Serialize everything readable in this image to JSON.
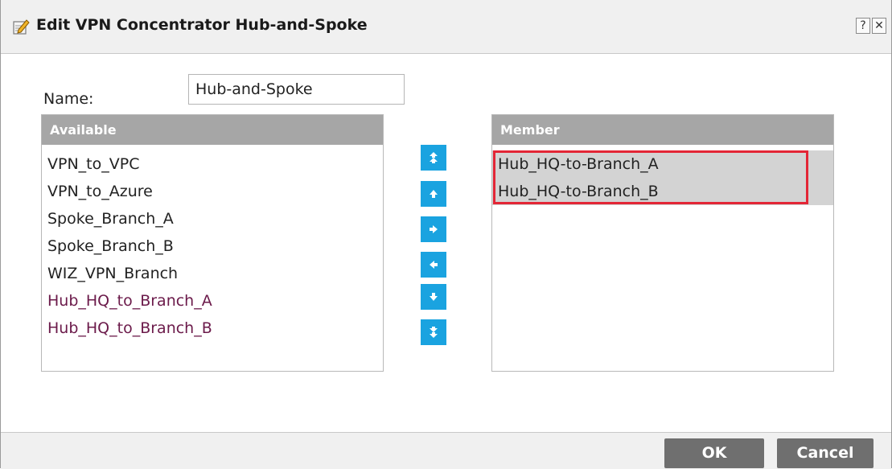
{
  "dialog": {
    "title": "Edit VPN Concentrator Hub-and-Spoke",
    "help_label": "?",
    "close_label": "✕"
  },
  "form": {
    "name_label": "Name:",
    "name_value": "Hub-and-Spoke"
  },
  "available": {
    "header": "Available",
    "items": [
      "VPN_to_VPC",
      "VPN_to_Azure",
      "Spoke_Branch_A",
      "Spoke_Branch_B",
      "WIZ_VPN_Branch",
      "Hub_HQ_to_Branch_A",
      "Hub_HQ_to_Branch_B"
    ]
  },
  "member": {
    "header": "Member",
    "items": [
      "Hub_HQ-to-Branch_A",
      "Hub_HQ-to-Branch_B"
    ]
  },
  "mover_buttons": [
    {
      "icon": "double-up-arrow-icon"
    },
    {
      "icon": "up-arrow-icon"
    },
    {
      "icon": "right-arrow-icon"
    },
    {
      "icon": "left-arrow-icon"
    },
    {
      "icon": "down-arrow-icon"
    },
    {
      "icon": "double-down-arrow-icon"
    }
  ],
  "actions": {
    "ok_label": "OK",
    "cancel_label": "Cancel"
  },
  "colors": {
    "accent": "#1aa3e0",
    "header_gray": "#a6a6a6",
    "selection_gray": "#d3d3d3",
    "highlight_red": "#e32636",
    "button_gray": "#6f6f6f"
  }
}
